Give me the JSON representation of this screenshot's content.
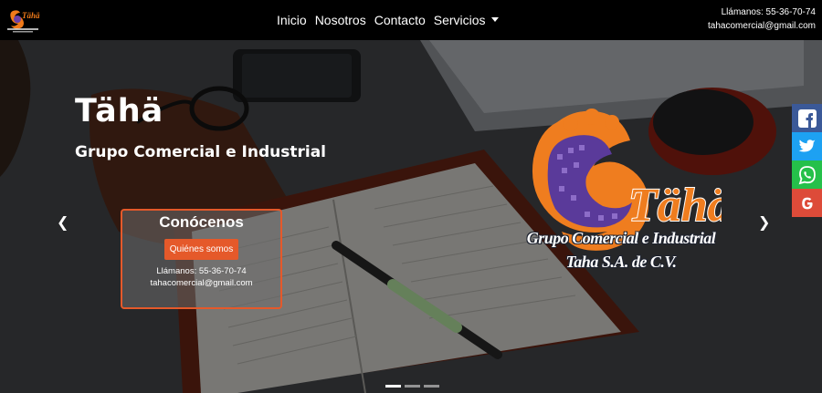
{
  "navbar": {
    "links": [
      {
        "label": "Inicio"
      },
      {
        "label": "Nosotros"
      },
      {
        "label": "Contacto"
      },
      {
        "label": "Servicios"
      }
    ],
    "contact_phone": "Llámanos: 55-36-70-74",
    "contact_email": "tahacomercial@gmail.com"
  },
  "hero": {
    "title": "Tähä",
    "subtitle": "Grupo Comercial e Industrial",
    "card": {
      "title": "Conócenos",
      "button_label": "Quiénes somos",
      "phone": "Llámanos: 55-36-70-74",
      "email": "tahacomercial@gmail.com"
    },
    "brand": {
      "logo_text": "Tähä",
      "line1": "Grupo Comercial e Industrial",
      "line2": "Taha S.A. de C.V."
    },
    "carousel": {
      "prev_icon": "chevron-left-icon",
      "next_icon": "chevron-right-icon",
      "slides_total": 3,
      "active_slide": 1
    }
  },
  "social": [
    {
      "name": "facebook",
      "icon": "facebook-icon"
    },
    {
      "name": "twitter",
      "icon": "twitter-icon"
    },
    {
      "name": "whatsapp",
      "icon": "whatsapp-icon"
    },
    {
      "name": "google",
      "icon": "google-icon"
    }
  ],
  "colors": {
    "accent": "#e5592a",
    "navbar_bg": "#000000",
    "facebook": "#3b5998",
    "twitter": "#1da1f2",
    "whatsapp": "#25c04a",
    "google": "#dd4b39",
    "brand_purple": "#5a3a9a"
  }
}
